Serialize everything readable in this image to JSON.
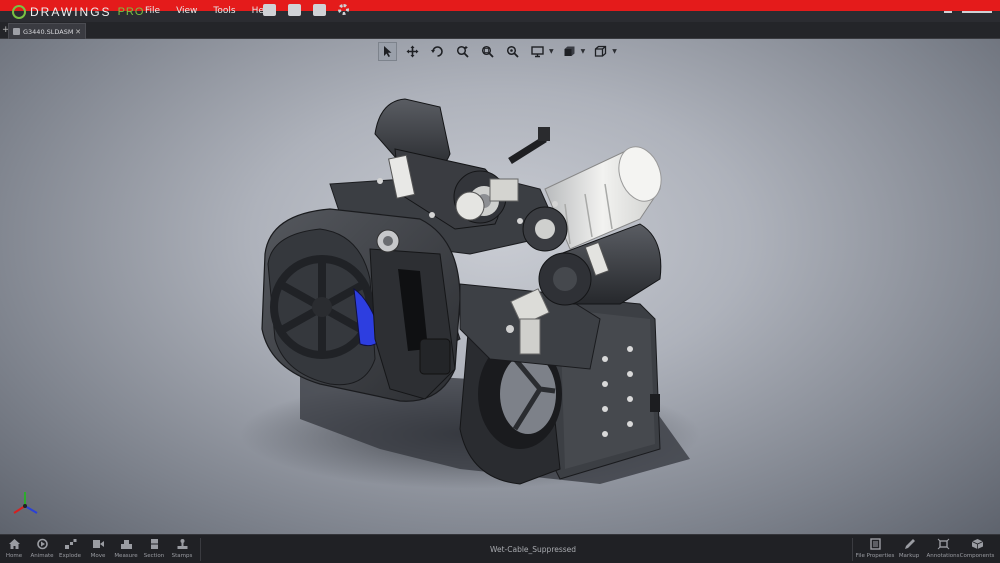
{
  "app": {
    "brand_main": "DRAWINGS",
    "brand_suffix": "PRO"
  },
  "menu": {
    "items": [
      "File",
      "View",
      "Tools",
      "Help"
    ]
  },
  "tabs": {
    "active_document": "G3440.SLDASM"
  },
  "view_toolbar": {
    "tools": [
      "select",
      "pan",
      "rotate",
      "zoom",
      "zoom-window",
      "zoom-fit",
      "display",
      "view-orientation",
      "section"
    ]
  },
  "bottom_toolbar": {
    "left": [
      {
        "label": "Home",
        "icon": "home-icon"
      },
      {
        "label": "Animate",
        "icon": "animate-icon"
      },
      {
        "label": "Explode",
        "icon": "explode-icon"
      },
      {
        "label": "Move",
        "icon": "move-icon"
      },
      {
        "label": "Measure",
        "icon": "measure-icon"
      },
      {
        "label": "Section",
        "icon": "section-icon"
      },
      {
        "label": "Stamps",
        "icon": "stamps-icon"
      }
    ],
    "status": "Wet-Cable_Suppressed",
    "right": [
      {
        "label": "File Properties",
        "icon": "file-properties-icon"
      },
      {
        "label": "Markup",
        "icon": "markup-icon"
      },
      {
        "label": "Annotations",
        "icon": "annotations-icon"
      },
      {
        "label": "Components",
        "icon": "components-icon"
      }
    ]
  },
  "colors": {
    "accent_red": "#e41b1b",
    "brand_green": "#7ac143",
    "chrome_dark": "#2b2c31"
  }
}
